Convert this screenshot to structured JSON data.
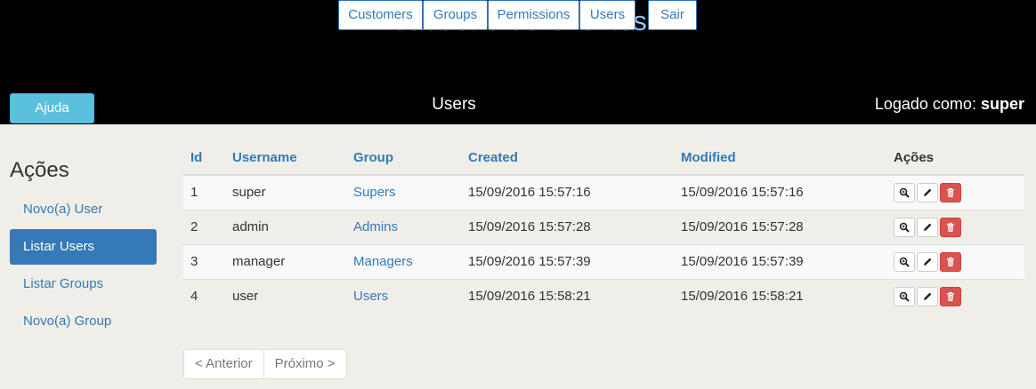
{
  "header": {
    "title": "Cadastro de Clientes",
    "nav": [
      "Customers",
      "Groups",
      "Permissions",
      "Users",
      "Sair"
    ],
    "help": "Ajuda",
    "section": "Users",
    "logged_label": "Logado como:",
    "logged_user": "super"
  },
  "sidebar": {
    "heading": "Ações",
    "items": [
      "Novo(a) User",
      "Listar Users",
      "Listar Groups",
      "Novo(a) Group"
    ]
  },
  "table": {
    "headers": [
      "Id",
      "Username",
      "Group",
      "Created",
      "Modified",
      "Ações"
    ],
    "rows": [
      [
        "1",
        "super",
        "Supers",
        "15/09/2016 15:57:16",
        "15/09/2016 15:57:16"
      ],
      [
        "2",
        "admin",
        "Admins",
        "15/09/2016 15:57:28",
        "15/09/2016 15:57:28"
      ],
      [
        "3",
        "manager",
        "Managers",
        "15/09/2016 15:57:39",
        "15/09/2016 15:57:39"
      ],
      [
        "4",
        "user",
        "Users",
        "15/09/2016 15:58:21",
        "15/09/2016 15:58:21"
      ]
    ],
    "action_icons": [
      "view-icon",
      "edit-icon",
      "delete-icon"
    ]
  },
  "pager": {
    "prev": "< Anterior",
    "next": "Próximo >"
  }
}
